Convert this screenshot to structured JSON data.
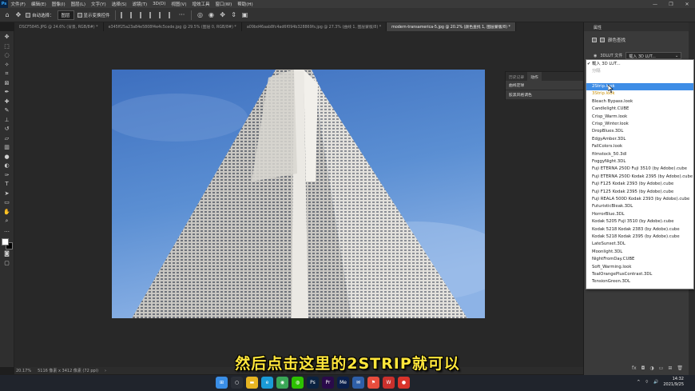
{
  "app": {
    "logo": "Ps"
  },
  "menu": [
    "文件(F)",
    "编辑(E)",
    "图像(I)",
    "图层(L)",
    "文字(Y)",
    "选择(S)",
    "滤镜(T)",
    "3D(D)",
    "视图(V)",
    "增效工具",
    "窗口(W)",
    "帮助(H)"
  ],
  "window_controls": {
    "minimize": "—",
    "restore": "❐",
    "close": "✕"
  },
  "options": {
    "auto_select_label": "自动选择：",
    "auto_select_value": "图层",
    "show_transform_label": "显示变换控件",
    "more": "···"
  },
  "tabs": [
    "DSCF5845.JPG @ 24.6% (背景, RGB/8#) *",
    "e345ff25a23a84e5808f4e4c5cede.jpg @ 29.5% (图层 0, RGB/8#) *",
    "a09bd46aab8fc4ad6f094b328869fs.jpg @ 27.3% (曲线 1, 图层蒙版/8) *",
    "modern-transamerica-5.jpg @ 20.2% (颜色查找 1, 图层蒙版/8) *"
  ],
  "float_panel": {
    "tabs": [
      "历史记录",
      "动作"
    ],
    "rows": [
      "曲线定球",
      "胶黑风格调色"
    ]
  },
  "status": {
    "zoom": "20.17%",
    "doc_size": "5116 像素 x 3412 像素 (72 ppi)",
    "arrow": "›"
  },
  "properties": {
    "tab": "属性",
    "title": "颜色查找",
    "lut_label": "3DLUT 文件",
    "lut_value": "载入 3D LUT..."
  },
  "dropdown": {
    "header": "载入 3D LUT...",
    "disabled": "分隔",
    "items": [
      "2Strip.look",
      "3Strip.look",
      "Bleach Bypass.look",
      "Candlelight.CUBE",
      "Crisp_Warm.look",
      "Crisp_Winter.look",
      "DropBlues.3DL",
      "EdgyAmber.3DL",
      "FallColors.look",
      "filmstock_50.3dl",
      "FoggyNight.3DL",
      "Fuji ETERNA 250D Fuji 3510 (by Adobe).cube",
      "Fuji ETERNA 250D Kodak 2395 (by Adobe).cube",
      "Fuji F125 Kodak 2393 (by Adobe).cube",
      "Fuji F125 Kodak 2395 (by Adobe).cube",
      "Fuji REALA 500D Kodak 2393 (by Adobe).cube",
      "FuturisticBleak.3DL",
      "HorrorBlue.3DL",
      "Kodak 5205 Fuji 3510 (by Adobe).cube",
      "Kodak 5218 Kodak 2383 (by Adobe).cube",
      "Kodak 5218 Kodak 2395 (by Adobe).cube",
      "LateSunset.3DL",
      "Moonlight.3DL",
      "NightFromDay.CUBE",
      "Soft_Warming.look",
      "TealOrangePlusContrast.3DL",
      "TensionGreen.3DL"
    ]
  },
  "subtitle": "然后点击这里的2STRIP就可以",
  "taskbar": {
    "apps": [
      {
        "name": "windows-start",
        "label": "⊞",
        "color": "#3a8ee6"
      },
      {
        "name": "search",
        "label": "○",
        "color": "#2a2e36"
      },
      {
        "name": "file-explorer",
        "label": "▬",
        "color": "#e6b422"
      },
      {
        "name": "edge",
        "label": "e",
        "color": "#1a9bd7"
      },
      {
        "name": "chrome",
        "label": "◉",
        "color": "#3aa757"
      },
      {
        "name": "wechat",
        "label": "◍",
        "color": "#2dc100"
      },
      {
        "name": "photoshop",
        "label": "Ps",
        "color": "#0b2240"
      },
      {
        "name": "premiere",
        "label": "Pr",
        "color": "#2a0a4a"
      },
      {
        "name": "media-encoder",
        "label": "Me",
        "color": "#0a1e4a"
      },
      {
        "name": "mail",
        "label": "✉",
        "color": "#2e5fa8"
      },
      {
        "name": "app-flag",
        "label": "⚑",
        "color": "#e84d3d"
      },
      {
        "name": "wps",
        "label": "W",
        "color": "#c9302c"
      },
      {
        "name": "recorder",
        "label": "●",
        "color": "#d9342b"
      }
    ],
    "tray": {
      "caret": "^",
      "time": "14:32",
      "date": "2021/9/25"
    }
  }
}
